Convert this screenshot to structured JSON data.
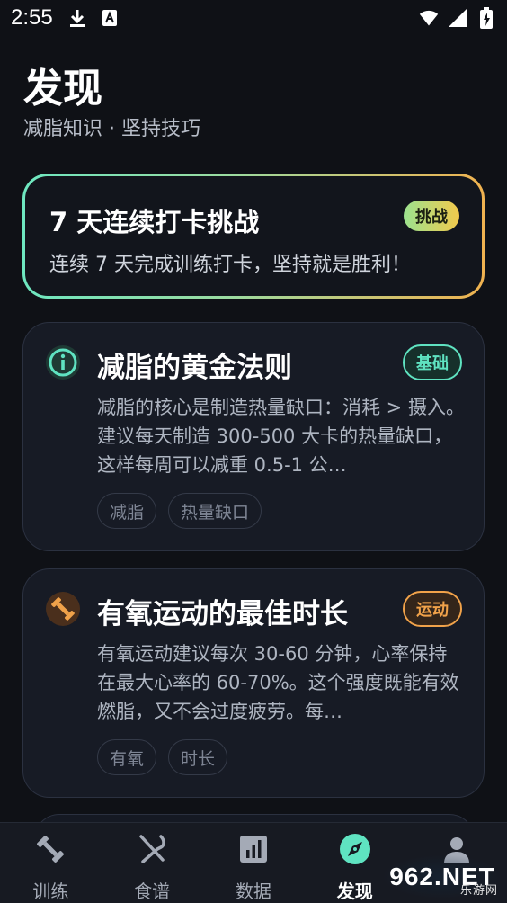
{
  "status_bar": {
    "time": "2:55"
  },
  "header": {
    "title": "发现",
    "subtitle": "减脂知识 · 坚持技巧"
  },
  "challenge": {
    "title": "7 天连续打卡挑战",
    "description": "连续 7 天完成训练打卡，坚持就是胜利！",
    "badge": "挑战"
  },
  "tips": [
    {
      "icon": "info-icon",
      "title": "减脂的黄金法则",
      "badge": "基础",
      "badge_color": "#5fe3c1",
      "body": "减脂的核心是制造热量缺口：消耗 > 摄入。建议每天制造 300-500 大卡的热量缺口，这样每周可以减重 0.5-1 公…",
      "tags": [
        "减脂",
        "热量缺口"
      ]
    },
    {
      "icon": "dumbbell-icon",
      "title": "有氧运动的最佳时长",
      "badge": "运动",
      "badge_color": "#f0a24a",
      "body": "有氧运动建议每次 30-60 分钟，心率保持在最大心率的 60-70%。这个强度既能有效燃脂，又不会过度疲劳。每…",
      "tags": [
        "有氧",
        "时长"
      ]
    }
  ],
  "bottom_nav": {
    "items": [
      {
        "label": "训练",
        "icon": "dumbbell-icon",
        "active": false
      },
      {
        "label": "食谱",
        "icon": "utensils-icon",
        "active": false
      },
      {
        "label": "数据",
        "icon": "bar-chart-icon",
        "active": false
      },
      {
        "label": "发现",
        "icon": "compass-icon",
        "active": true
      },
      {
        "label": "",
        "icon": "profile-icon",
        "active": false
      }
    ]
  },
  "watermark": {
    "brand": "962.NET",
    "sub": "乐游网"
  },
  "colors": {
    "accent": "#5fe3c1",
    "warning": "#f0a24a",
    "background": "#0f1116"
  }
}
